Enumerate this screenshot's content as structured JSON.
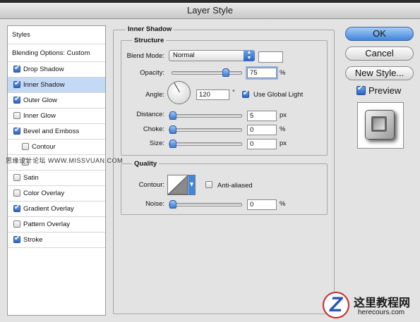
{
  "window": {
    "title": "Layer Style"
  },
  "styles_list": {
    "header": "Styles",
    "blending_options": "Blending Options: Custom",
    "items": [
      {
        "label": "Drop Shadow",
        "checked": true,
        "selected": false
      },
      {
        "label": "Inner Shadow",
        "checked": true,
        "selected": true
      },
      {
        "label": "Outer Glow",
        "checked": true,
        "selected": false
      },
      {
        "label": "Inner Glow",
        "checked": false,
        "selected": false
      },
      {
        "label": "Bevel and Emboss",
        "checked": true,
        "selected": false
      },
      {
        "label": "Contour",
        "checked": false,
        "selected": false
      },
      {
        "label": "Texture",
        "checked": false,
        "selected": false
      },
      {
        "label": "Satin",
        "checked": false,
        "selected": false
      },
      {
        "label": "Color Overlay",
        "checked": false,
        "selected": false
      },
      {
        "label": "Gradient Overlay",
        "checked": true,
        "selected": false
      },
      {
        "label": "Pattern Overlay",
        "checked": false,
        "selected": false
      },
      {
        "label": "Stroke",
        "checked": true,
        "selected": false
      }
    ]
  },
  "watermark": "思缘设计论坛 WWW.MISSVUAN.COM",
  "inner_shadow": {
    "title": "Inner Shadow",
    "structure": {
      "title": "Structure",
      "blend_mode_label": "Blend Mode:",
      "blend_mode_value": "Normal",
      "blend_color": "#ffffff",
      "opacity_label": "Opacity:",
      "opacity_value": "75",
      "opacity_unit": "%",
      "angle_label": "Angle:",
      "angle_value": "120",
      "angle_unit": "°",
      "use_global_light_label": "Use Global Light",
      "use_global_light": true,
      "distance_label": "Distance:",
      "distance_value": "5",
      "distance_unit": "px",
      "choke_label": "Choke:",
      "choke_value": "0",
      "choke_unit": "%",
      "size_label": "Size:",
      "size_value": "0",
      "size_unit": "px"
    },
    "quality": {
      "title": "Quality",
      "contour_label": "Contour:",
      "anti_aliased_label": "Anti-aliased",
      "anti_aliased": false,
      "noise_label": "Noise:",
      "noise_value": "0",
      "noise_unit": "%"
    }
  },
  "buttons": {
    "ok": "OK",
    "cancel": "Cancel",
    "new_style": "New Style..."
  },
  "preview": {
    "label": "Preview",
    "checked": true
  },
  "logo": {
    "name": "这里教程网",
    "url": "herecours.com"
  },
  "colors": {
    "selection": "#c4d9f5",
    "accent": "#3f86dc"
  }
}
